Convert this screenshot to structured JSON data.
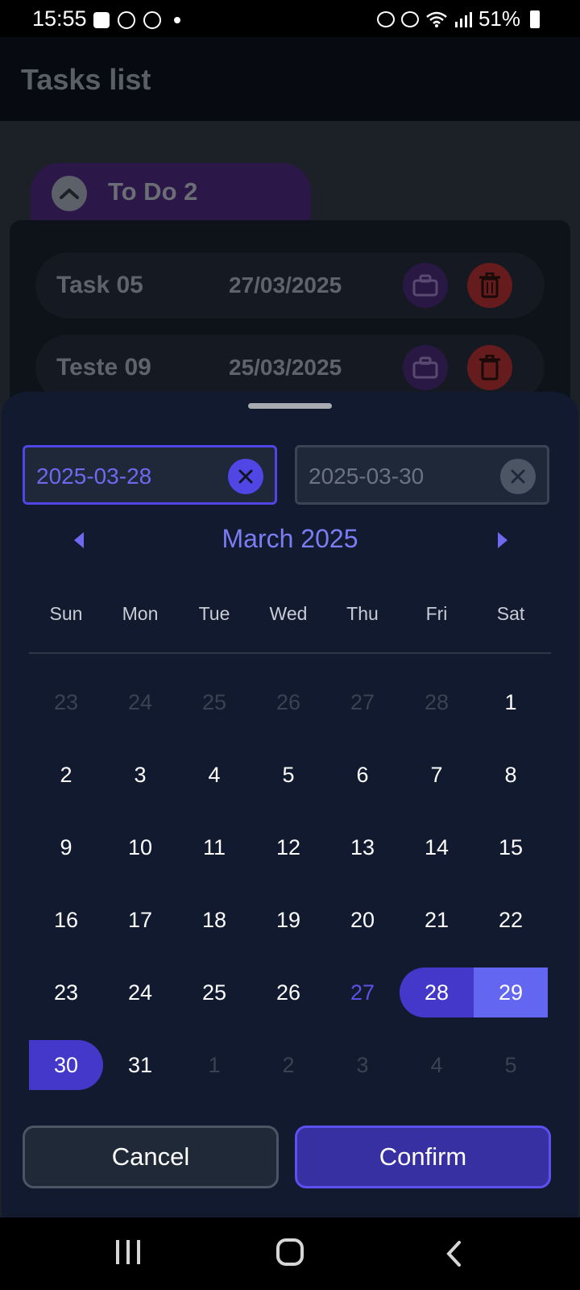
{
  "status_bar": {
    "time": "15:55",
    "battery": "51%"
  },
  "app": {
    "title": "Tasks list",
    "group": {
      "label": "To Do 2",
      "expanded": true
    },
    "tasks": [
      {
        "name": "Task 05",
        "date": "27/03/2025"
      },
      {
        "name": "Teste 09",
        "date": "25/03/2025"
      }
    ]
  },
  "date_picker": {
    "start_date": "2025-03-28",
    "end_date": "2025-03-30",
    "month_title": "March 2025",
    "weekdays": [
      "Sun",
      "Mon",
      "Tue",
      "Wed",
      "Thu",
      "Fri",
      "Sat"
    ],
    "days": [
      {
        "label": "23",
        "state": "muted"
      },
      {
        "label": "24",
        "state": "muted"
      },
      {
        "label": "25",
        "state": "muted"
      },
      {
        "label": "26",
        "state": "muted"
      },
      {
        "label": "27",
        "state": "muted"
      },
      {
        "label": "28",
        "state": "muted"
      },
      {
        "label": "1",
        "state": "normal"
      },
      {
        "label": "2",
        "state": "normal"
      },
      {
        "label": "3",
        "state": "normal"
      },
      {
        "label": "4",
        "state": "normal"
      },
      {
        "label": "5",
        "state": "normal"
      },
      {
        "label": "6",
        "state": "normal"
      },
      {
        "label": "7",
        "state": "normal"
      },
      {
        "label": "8",
        "state": "normal"
      },
      {
        "label": "9",
        "state": "normal"
      },
      {
        "label": "10",
        "state": "normal"
      },
      {
        "label": "11",
        "state": "normal"
      },
      {
        "label": "12",
        "state": "normal"
      },
      {
        "label": "13",
        "state": "normal"
      },
      {
        "label": "14",
        "state": "normal"
      },
      {
        "label": "15",
        "state": "normal"
      },
      {
        "label": "16",
        "state": "normal"
      },
      {
        "label": "17",
        "state": "normal"
      },
      {
        "label": "18",
        "state": "normal"
      },
      {
        "label": "19",
        "state": "normal"
      },
      {
        "label": "20",
        "state": "normal"
      },
      {
        "label": "21",
        "state": "normal"
      },
      {
        "label": "22",
        "state": "normal"
      },
      {
        "label": "23",
        "state": "normal"
      },
      {
        "label": "24",
        "state": "normal"
      },
      {
        "label": "25",
        "state": "normal"
      },
      {
        "label": "26",
        "state": "normal"
      },
      {
        "label": "27",
        "state": "today"
      },
      {
        "label": "28",
        "state": "range-start"
      },
      {
        "label": "29",
        "state": "in-range"
      },
      {
        "label": "30",
        "state": "range-end"
      },
      {
        "label": "31",
        "state": "normal"
      },
      {
        "label": "1",
        "state": "muted"
      },
      {
        "label": "2",
        "state": "muted"
      },
      {
        "label": "3",
        "state": "muted"
      },
      {
        "label": "4",
        "state": "muted"
      },
      {
        "label": "5",
        "state": "muted"
      }
    ],
    "cancel_label": "Cancel",
    "confirm_label": "Confirm"
  },
  "colors": {
    "accent": "#4f46e5",
    "range_fill": "#6366f1",
    "sheet_bg": "#111a2e"
  }
}
